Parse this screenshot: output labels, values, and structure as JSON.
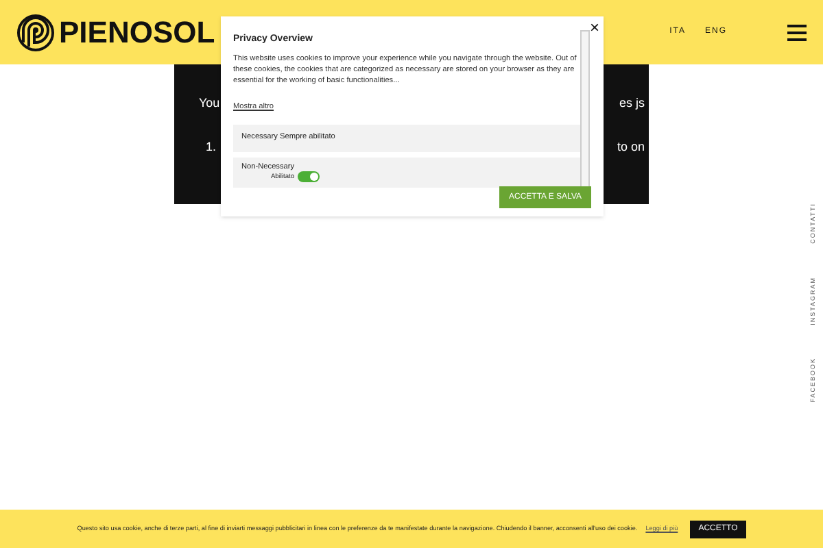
{
  "header": {
    "logo": "PIENOSOL",
    "languages": [
      {
        "label": "ITA",
        "selected": false
      },
      {
        "label": "ENG",
        "selected": false
      }
    ]
  },
  "content_panel": {
    "left_fragments": [
      "You",
      "1."
    ],
    "right_fragments": [
      "es js",
      "to on"
    ]
  },
  "side_links": [
    "CONTATTI",
    "INSTAGRAM",
    "FACEBOOK"
  ],
  "privacy_dialog": {
    "close": "×",
    "title": "Privacy Overview",
    "text": "This website uses cookies to improve your experience while you navigate through the website. Out of these cookies, the cookies that are categorized as necessary are stored on your browser as they are essential for the working of basic functionalities...",
    "more_link": "Mostra altro",
    "categories": [
      {
        "kind": "fixed",
        "label": "Necessary Sempre abilitato"
      },
      {
        "kind": "toggle",
        "label": "Non-Necessary",
        "toggle_label": "Abilitato",
        "on": true
      }
    ],
    "button": "ACCETTA E SALVA"
  },
  "cookie_bar": {
    "text": "Questo sito usa cookie, anche di terze parti, al fine di inviarti messaggi pubblicitari in linea con le preferenze da te manifestate durante la navigazione. Chiudendo il banner, acconsenti all'uso dei cookie.",
    "link": "Leggi di più",
    "button": "ACCETTO"
  }
}
